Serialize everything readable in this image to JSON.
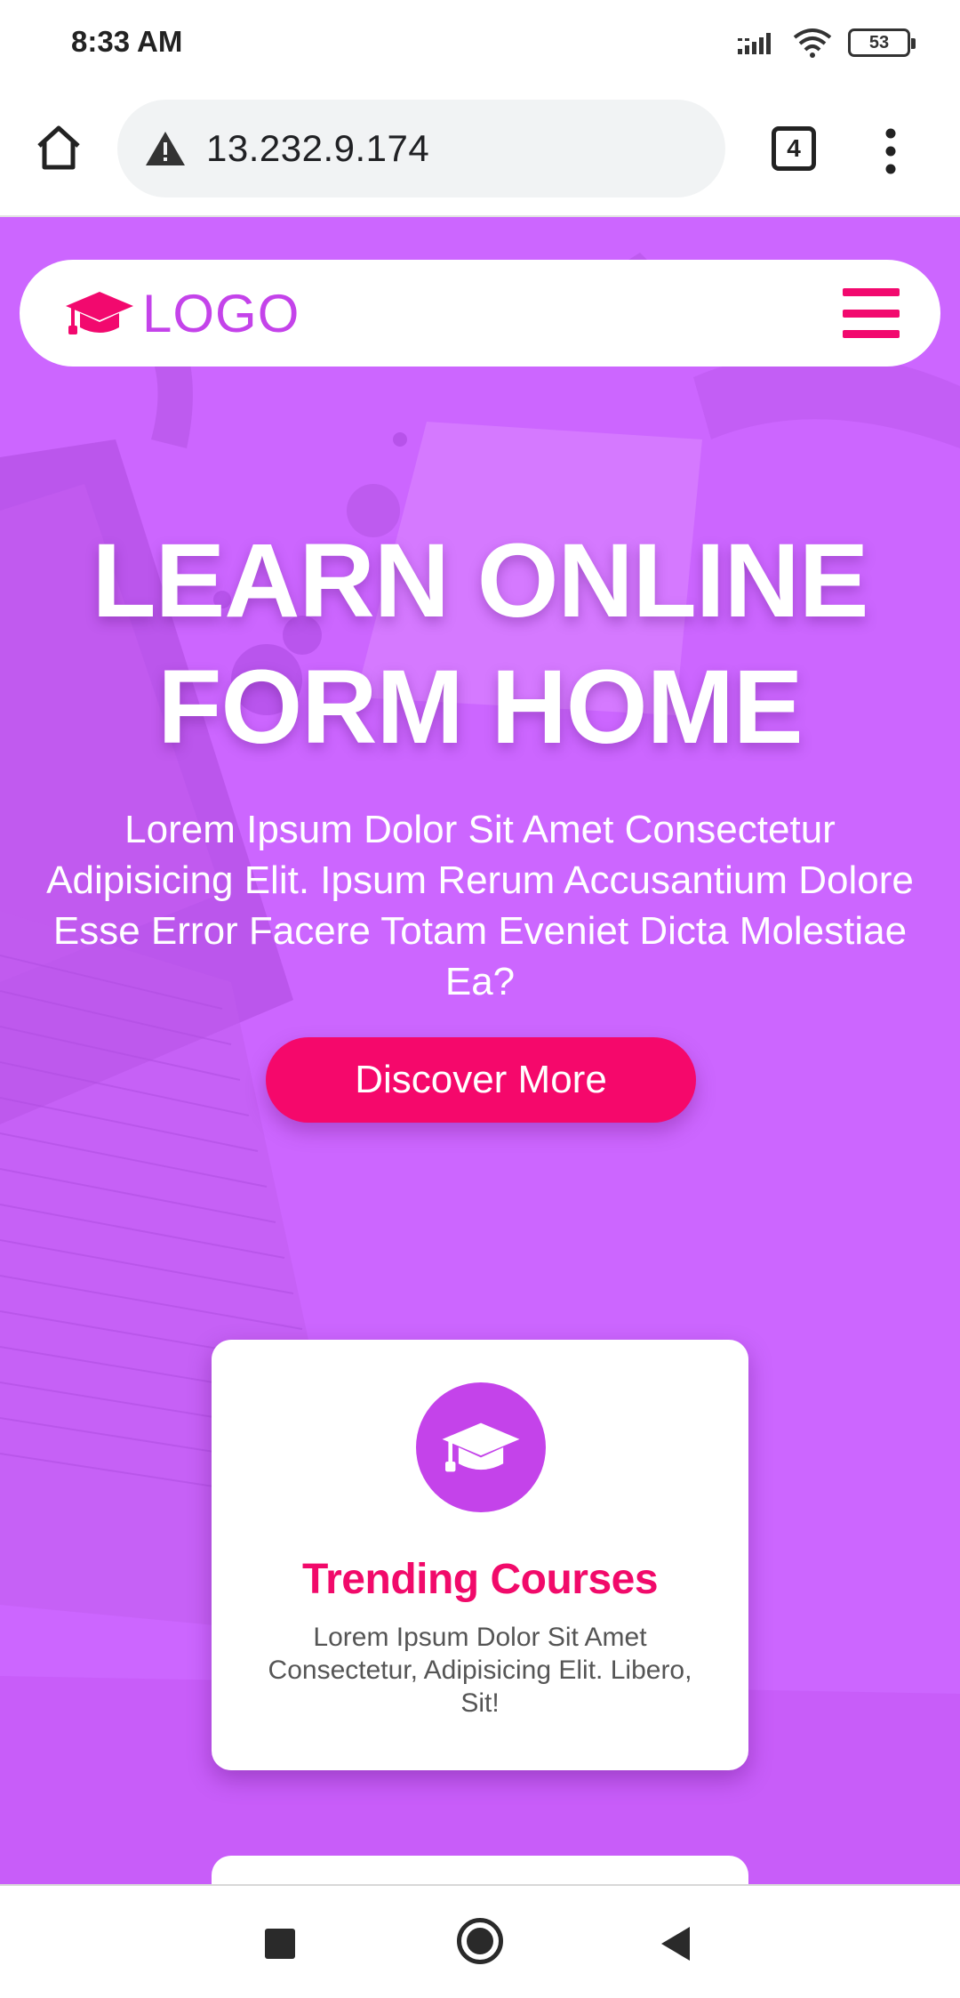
{
  "status_bar": {
    "time": "8:33 AM",
    "battery": "53",
    "icons": [
      "signal-icon",
      "wifi-icon",
      "battery-icon"
    ]
  },
  "browser": {
    "url": "13.232.9.174",
    "tab_count": "4",
    "icons": [
      "home-icon",
      "warning-icon",
      "tabs-icon",
      "more-vert-icon"
    ]
  },
  "navbar": {
    "logo_text": "LOGO",
    "logo_icon": "graduation-cap-icon",
    "menu_icon": "hamburger-menu-icon"
  },
  "hero": {
    "title_line1": "LEARN ONLINE",
    "title_line2": "FORM HOME",
    "description": "Lorem Ipsum Dolor Sit Amet Consectetur Adipisicing Elit. Ipsum Rerum Accusantium Dolore Esse Error Facere Totam Eveniet Dicta Molestiae Ea?",
    "cta_label": "Discover More"
  },
  "cards": [
    {
      "icon": "graduation-cap-icon",
      "title": "Trending Courses",
      "text": "Lorem Ipsum Dolor Sit Amet Consectetur, Adipisicing Elit. Libero, Sit!"
    }
  ],
  "colors": {
    "background": "#cc66ff",
    "accent_pink": "#f5086b",
    "accent_purple": "#c443ea",
    "white": "#ffffff"
  },
  "system_nav": {
    "icons": [
      "recent-apps-icon",
      "home-circle-icon",
      "back-icon"
    ]
  }
}
